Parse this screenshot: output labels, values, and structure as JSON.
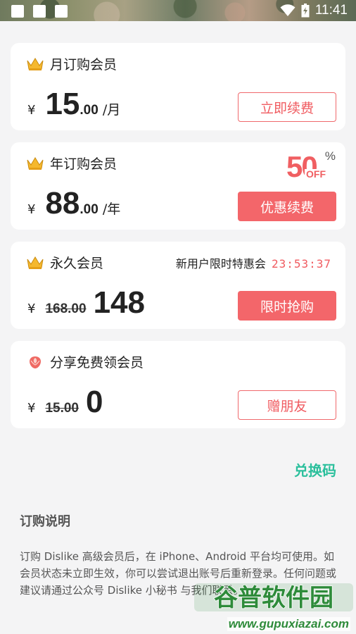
{
  "status_bar": {
    "time": "11:41"
  },
  "plans": [
    {
      "title": "月订购会员",
      "currency": "¥",
      "price_int": "15",
      "price_dec": ".00",
      "unit": "/月",
      "button": "立即续费",
      "button_style": "outline"
    },
    {
      "title": "年订购会员",
      "currency": "¥",
      "price_int": "88",
      "price_dec": ".00",
      "unit": "/年",
      "button": "优惠续费",
      "button_style": "filled",
      "badge": {
        "number": "50",
        "percent": "%",
        "off": "OFF"
      }
    },
    {
      "title": "永久会员",
      "currency": "¥",
      "original_price": "168.00",
      "price_int": "148",
      "button": "限时抢购",
      "button_style": "filled",
      "promo_label": "新用户限时特惠会",
      "countdown": "23:53:37"
    },
    {
      "title": "分享免费领会员",
      "currency": "¥",
      "original_price": "15.00",
      "price_int": "0",
      "button": "赠朋友",
      "button_style": "outline"
    }
  ],
  "redeem_code": "兑换码",
  "instructions": {
    "title": "订购说明",
    "text": "订购 Dislike 高级会员后，在 iPhone、Android 平台均可使用。如会员状态未立即生效，你可以尝试退出账号后重新登录。任何问题或建议请通过公众号 Dislike 小秘书 与我们联系。"
  },
  "watermark": {
    "logo": "谷普软件园",
    "url": "www.gupuxiazai.com"
  },
  "colors": {
    "accent": "#f3666a",
    "redeem": "#2bbf9c",
    "background": "#f4f4f5"
  }
}
